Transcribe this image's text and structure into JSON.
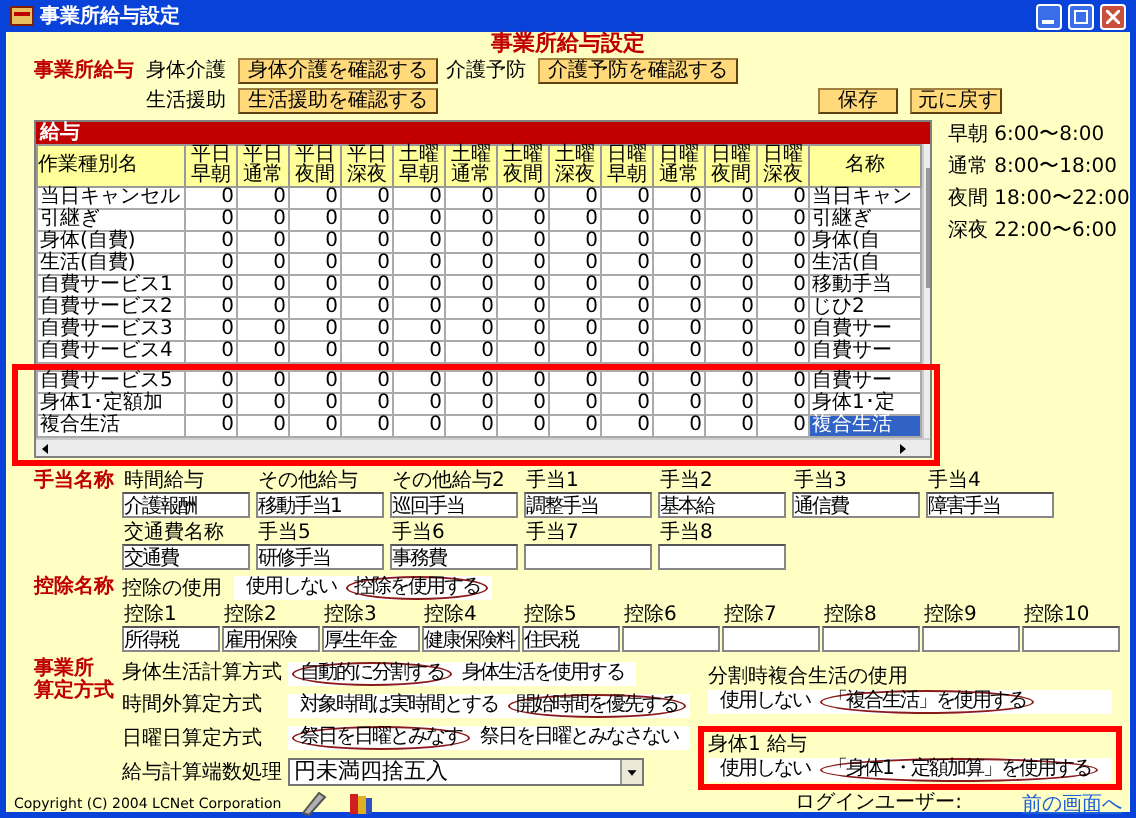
{
  "window": {
    "title": "事業所給与設定"
  },
  "heading": "事業所給与設定",
  "salary_section": {
    "label": "事業所給与",
    "confirm_items": [
      {
        "label": "身体介護",
        "button": "身体介護を確認する"
      },
      {
        "label": "介護予防",
        "button": "介護予防を確認する"
      },
      {
        "label": "生活援助",
        "button": "生活援助を確認する"
      }
    ],
    "actions": [
      "保存",
      "元に戻す"
    ]
  },
  "salary_table": {
    "title": "給与",
    "highlighted": true,
    "columns": [
      "作業種別名",
      "平日早朝",
      "平日通常",
      "平日夜間",
      "平日深夜",
      "土曜早朝",
      "土曜通常",
      "土曜夜間",
      "土曜深夜",
      "日曜早朝",
      "日曜通常",
      "日曜夜間",
      "日曜深夜",
      "名称"
    ],
    "rows": [
      {
        "cells": [
          "当日キャンセル",
          "0",
          "0",
          "0",
          "0",
          "0",
          "0",
          "0",
          "0",
          "0",
          "0",
          "0",
          "0",
          "当日キャン"
        ],
        "selected": false
      },
      {
        "cells": [
          "引継ぎ",
          "0",
          "0",
          "0",
          "0",
          "0",
          "0",
          "0",
          "0",
          "0",
          "0",
          "0",
          "0",
          "引継ぎ"
        ],
        "selected": false
      },
      {
        "cells": [
          "身体(自費)",
          "0",
          "0",
          "0",
          "0",
          "0",
          "0",
          "0",
          "0",
          "0",
          "0",
          "0",
          "0",
          "身体(自"
        ],
        "selected": false
      },
      {
        "cells": [
          "生活(自費)",
          "0",
          "0",
          "0",
          "0",
          "0",
          "0",
          "0",
          "0",
          "0",
          "0",
          "0",
          "0",
          "生活(自"
        ],
        "selected": false
      },
      {
        "cells": [
          "自費サービス1",
          "0",
          "0",
          "0",
          "0",
          "0",
          "0",
          "0",
          "0",
          "0",
          "0",
          "0",
          "0",
          "移動手当"
        ],
        "selected": false
      },
      {
        "cells": [
          "自費サービス2",
          "0",
          "0",
          "0",
          "0",
          "0",
          "0",
          "0",
          "0",
          "0",
          "0",
          "0",
          "0",
          "じひ2"
        ],
        "selected": false
      },
      {
        "cells": [
          "自費サービス3",
          "0",
          "0",
          "0",
          "0",
          "0",
          "0",
          "0",
          "0",
          "0",
          "0",
          "0",
          "0",
          "自費サー"
        ],
        "selected": false
      },
      {
        "cells": [
          "自費サービス4",
          "0",
          "0",
          "0",
          "0",
          "0",
          "0",
          "0",
          "0",
          "0",
          "0",
          "0",
          "0",
          "自費サー"
        ],
        "selected": false
      },
      {
        "cells": [
          "自費サービス5",
          "0",
          "0",
          "0",
          "0",
          "0",
          "0",
          "0",
          "0",
          "0",
          "0",
          "0",
          "0",
          "自費サー"
        ],
        "selected": false
      },
      {
        "cells": [
          "身体1･定額加",
          "0",
          "0",
          "0",
          "0",
          "0",
          "0",
          "0",
          "0",
          "0",
          "0",
          "0",
          "0",
          "身体1･定"
        ],
        "selected": false
      },
      {
        "cells": [
          "複合生活",
          "0",
          "0",
          "0",
          "0",
          "0",
          "0",
          "0",
          "0",
          "0",
          "0",
          "0",
          "0",
          "複合生活"
        ],
        "selected": true
      }
    ]
  },
  "time_bands": [
    "早朝 6:00〜8:00",
    "通常 8:00〜18:00",
    "夜間 18:00〜22:00",
    "深夜 22:00〜6:00"
  ],
  "allowances": {
    "label": "手当名称",
    "rows": [
      [
        {
          "label": "時間給与",
          "value": "介護報酬"
        },
        {
          "label": "その他給与",
          "value": "移動手当1"
        },
        {
          "label": "その他給与2",
          "value": "巡回手当"
        },
        {
          "label": "手当1",
          "value": "調整手当"
        },
        {
          "label": "手当2",
          "value": "基本給"
        },
        {
          "label": "手当3",
          "value": "通信費"
        },
        {
          "label": "手当4",
          "value": "障害手当"
        }
      ],
      [
        {
          "label": "交通費名称",
          "value": "交通費"
        },
        {
          "label": "手当5",
          "value": "研修手当"
        },
        {
          "label": "手当6",
          "value": "事務費"
        },
        {
          "label": "手当7"
        },
        {
          "label": "手当8"
        }
      ]
    ]
  },
  "deductions": {
    "label": "控除名称",
    "usage_label": "控除の使用",
    "usage_options": [
      {
        "label": "使用しない",
        "selected": false
      },
      {
        "label": "控除を使用する",
        "selected": true
      }
    ],
    "fields": [
      {
        "label": "控除1",
        "value": "所得税"
      },
      {
        "label": "控除2",
        "value": "雇用保険"
      },
      {
        "label": "控除3",
        "value": "厚生年金"
      },
      {
        "label": "控除4",
        "value": "健康保険料"
      },
      {
        "label": "控除5",
        "value": "住民税"
      },
      {
        "label": "控除6"
      },
      {
        "label": "控除7"
      },
      {
        "label": "控除8"
      },
      {
        "label": "控除9"
      },
      {
        "label": "控除10"
      }
    ]
  },
  "calculation": {
    "label_lines": [
      "事業所",
      "算定方式"
    ],
    "methods": [
      {
        "label": "身体生活計算方式",
        "options": [
          {
            "label": "自動的に分割する",
            "selected": true
          },
          {
            "label": "身体生活を使用する",
            "selected": false
          }
        ]
      },
      {
        "label": "時間外算定方式",
        "options": [
          {
            "label": "対象時間は実時間とする",
            "selected": false
          },
          {
            "label": "開始時間を優先する",
            "selected": true
          }
        ]
      },
      {
        "label": "日曜日算定方式",
        "options": [
          {
            "label": "祭日を日曜とみなす",
            "selected": true
          },
          {
            "label": "祭日を日曜とみなさない",
            "selected": false
          }
        ]
      }
    ],
    "rounding": {
      "label": "給与計算端数処理",
      "value": "円未満四捨五入"
    },
    "split_usage": {
      "label": "分割時複合生活の使用",
      "options": [
        {
          "label": "使用しない",
          "selected": false
        },
        {
          "label": "「複合生活」を使用する",
          "selected": true
        }
      ]
    },
    "body1": {
      "label": "身体1 給与",
      "highlighted": true,
      "options": [
        {
          "label": "使用しない",
          "selected": false
        },
        {
          "label": "「身体1・定額加算」を使用する",
          "selected": true
        }
      ]
    }
  },
  "footer": {
    "copyright": "Copyright (C) 2004 LCNet Corporation",
    "login_label": "ログインユーザー:",
    "back_link": "前の画面へ"
  }
}
